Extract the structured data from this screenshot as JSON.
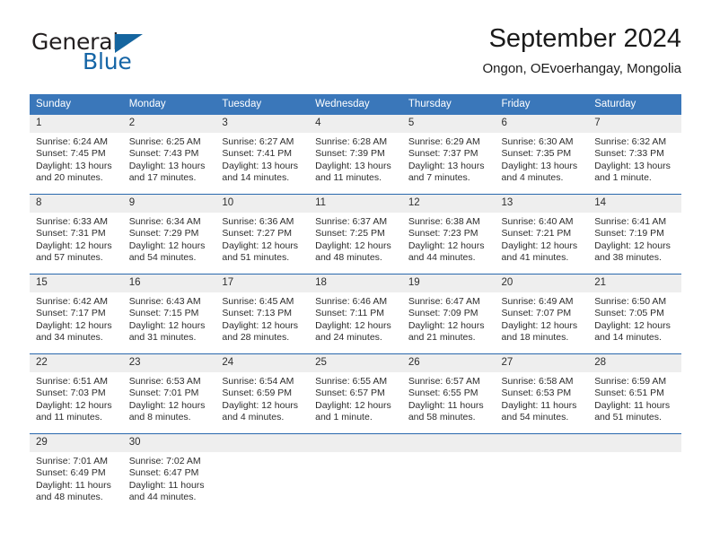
{
  "logo": {
    "word1": "General",
    "word2": "Blue",
    "triangle_color": "#15659f",
    "text_color": "#231f20"
  },
  "header": {
    "title": "September 2024",
    "subtitle": "Ongon, OEvoerhangay, Mongolia"
  },
  "theme": {
    "header_blue": "#3a77ba",
    "row_divider_blue": "#2a68ad",
    "daynum_band": "#eeeeee"
  },
  "calendar": {
    "weekdays": [
      "Sunday",
      "Monday",
      "Tuesday",
      "Wednesday",
      "Thursday",
      "Friday",
      "Saturday"
    ],
    "weeks": [
      [
        {
          "day": "1",
          "sunrise": "Sunrise: 6:24 AM",
          "sunset": "Sunset: 7:45 PM",
          "daylight": "Daylight: 13 hours and 20 minutes."
        },
        {
          "day": "2",
          "sunrise": "Sunrise: 6:25 AM",
          "sunset": "Sunset: 7:43 PM",
          "daylight": "Daylight: 13 hours and 17 minutes."
        },
        {
          "day": "3",
          "sunrise": "Sunrise: 6:27 AM",
          "sunset": "Sunset: 7:41 PM",
          "daylight": "Daylight: 13 hours and 14 minutes."
        },
        {
          "day": "4",
          "sunrise": "Sunrise: 6:28 AM",
          "sunset": "Sunset: 7:39 PM",
          "daylight": "Daylight: 13 hours and 11 minutes."
        },
        {
          "day": "5",
          "sunrise": "Sunrise: 6:29 AM",
          "sunset": "Sunset: 7:37 PM",
          "daylight": "Daylight: 13 hours and 7 minutes."
        },
        {
          "day": "6",
          "sunrise": "Sunrise: 6:30 AM",
          "sunset": "Sunset: 7:35 PM",
          "daylight": "Daylight: 13 hours and 4 minutes."
        },
        {
          "day": "7",
          "sunrise": "Sunrise: 6:32 AM",
          "sunset": "Sunset: 7:33 PM",
          "daylight": "Daylight: 13 hours and 1 minute."
        }
      ],
      [
        {
          "day": "8",
          "sunrise": "Sunrise: 6:33 AM",
          "sunset": "Sunset: 7:31 PM",
          "daylight": "Daylight: 12 hours and 57 minutes."
        },
        {
          "day": "9",
          "sunrise": "Sunrise: 6:34 AM",
          "sunset": "Sunset: 7:29 PM",
          "daylight": "Daylight: 12 hours and 54 minutes."
        },
        {
          "day": "10",
          "sunrise": "Sunrise: 6:36 AM",
          "sunset": "Sunset: 7:27 PM",
          "daylight": "Daylight: 12 hours and 51 minutes."
        },
        {
          "day": "11",
          "sunrise": "Sunrise: 6:37 AM",
          "sunset": "Sunset: 7:25 PM",
          "daylight": "Daylight: 12 hours and 48 minutes."
        },
        {
          "day": "12",
          "sunrise": "Sunrise: 6:38 AM",
          "sunset": "Sunset: 7:23 PM",
          "daylight": "Daylight: 12 hours and 44 minutes."
        },
        {
          "day": "13",
          "sunrise": "Sunrise: 6:40 AM",
          "sunset": "Sunset: 7:21 PM",
          "daylight": "Daylight: 12 hours and 41 minutes."
        },
        {
          "day": "14",
          "sunrise": "Sunrise: 6:41 AM",
          "sunset": "Sunset: 7:19 PM",
          "daylight": "Daylight: 12 hours and 38 minutes."
        }
      ],
      [
        {
          "day": "15",
          "sunrise": "Sunrise: 6:42 AM",
          "sunset": "Sunset: 7:17 PM",
          "daylight": "Daylight: 12 hours and 34 minutes."
        },
        {
          "day": "16",
          "sunrise": "Sunrise: 6:43 AM",
          "sunset": "Sunset: 7:15 PM",
          "daylight": "Daylight: 12 hours and 31 minutes."
        },
        {
          "day": "17",
          "sunrise": "Sunrise: 6:45 AM",
          "sunset": "Sunset: 7:13 PM",
          "daylight": "Daylight: 12 hours and 28 minutes."
        },
        {
          "day": "18",
          "sunrise": "Sunrise: 6:46 AM",
          "sunset": "Sunset: 7:11 PM",
          "daylight": "Daylight: 12 hours and 24 minutes."
        },
        {
          "day": "19",
          "sunrise": "Sunrise: 6:47 AM",
          "sunset": "Sunset: 7:09 PM",
          "daylight": "Daylight: 12 hours and 21 minutes."
        },
        {
          "day": "20",
          "sunrise": "Sunrise: 6:49 AM",
          "sunset": "Sunset: 7:07 PM",
          "daylight": "Daylight: 12 hours and 18 minutes."
        },
        {
          "day": "21",
          "sunrise": "Sunrise: 6:50 AM",
          "sunset": "Sunset: 7:05 PM",
          "daylight": "Daylight: 12 hours and 14 minutes."
        }
      ],
      [
        {
          "day": "22",
          "sunrise": "Sunrise: 6:51 AM",
          "sunset": "Sunset: 7:03 PM",
          "daylight": "Daylight: 12 hours and 11 minutes."
        },
        {
          "day": "23",
          "sunrise": "Sunrise: 6:53 AM",
          "sunset": "Sunset: 7:01 PM",
          "daylight": "Daylight: 12 hours and 8 minutes."
        },
        {
          "day": "24",
          "sunrise": "Sunrise: 6:54 AM",
          "sunset": "Sunset: 6:59 PM",
          "daylight": "Daylight: 12 hours and 4 minutes."
        },
        {
          "day": "25",
          "sunrise": "Sunrise: 6:55 AM",
          "sunset": "Sunset: 6:57 PM",
          "daylight": "Daylight: 12 hours and 1 minute."
        },
        {
          "day": "26",
          "sunrise": "Sunrise: 6:57 AM",
          "sunset": "Sunset: 6:55 PM",
          "daylight": "Daylight: 11 hours and 58 minutes."
        },
        {
          "day": "27",
          "sunrise": "Sunrise: 6:58 AM",
          "sunset": "Sunset: 6:53 PM",
          "daylight": "Daylight: 11 hours and 54 minutes."
        },
        {
          "day": "28",
          "sunrise": "Sunrise: 6:59 AM",
          "sunset": "Sunset: 6:51 PM",
          "daylight": "Daylight: 11 hours and 51 minutes."
        }
      ],
      [
        {
          "day": "29",
          "sunrise": "Sunrise: 7:01 AM",
          "sunset": "Sunset: 6:49 PM",
          "daylight": "Daylight: 11 hours and 48 minutes."
        },
        {
          "day": "30",
          "sunrise": "Sunrise: 7:02 AM",
          "sunset": "Sunset: 6:47 PM",
          "daylight": "Daylight: 11 hours and 44 minutes."
        },
        {
          "day": "",
          "sunrise": "",
          "sunset": "",
          "daylight": ""
        },
        {
          "day": "",
          "sunrise": "",
          "sunset": "",
          "daylight": ""
        },
        {
          "day": "",
          "sunrise": "",
          "sunset": "",
          "daylight": ""
        },
        {
          "day": "",
          "sunrise": "",
          "sunset": "",
          "daylight": ""
        },
        {
          "day": "",
          "sunrise": "",
          "sunset": "",
          "daylight": ""
        }
      ]
    ]
  }
}
